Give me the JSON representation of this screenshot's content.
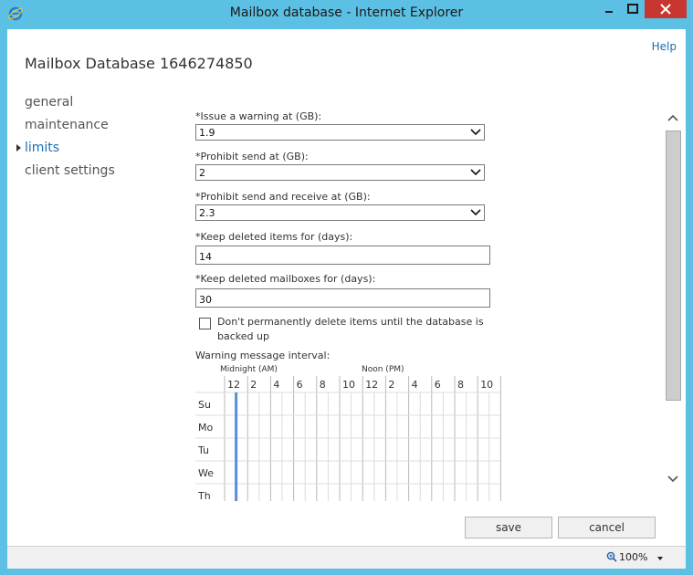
{
  "window": {
    "title": "Mailbox database - Internet Explorer",
    "controls": [
      "minimize",
      "maximize",
      "close"
    ]
  },
  "header": {
    "help_label": "Help",
    "page_title": "Mailbox Database 1646274850"
  },
  "sidebar": {
    "items": [
      {
        "label": "general",
        "active": false
      },
      {
        "label": "maintenance",
        "active": false
      },
      {
        "label": "limits",
        "active": true
      },
      {
        "label": "client settings",
        "active": false
      }
    ]
  },
  "form": {
    "issue_warning": {
      "label": "*Issue a warning at (GB):",
      "value": "1.9"
    },
    "prohibit_send": {
      "label": "*Prohibit send at (GB):",
      "value": "2"
    },
    "prohibit_send_receive": {
      "label": "*Prohibit send and receive at (GB):",
      "value": "2.3"
    },
    "keep_deleted_items": {
      "label": "*Keep deleted items for (days):",
      "value": "14"
    },
    "keep_deleted_mailboxes": {
      "label": "*Keep deleted mailboxes for (days):",
      "value": "30"
    },
    "dont_delete_until_backup": {
      "label": "Don't permanently delete items until the database is backed up",
      "checked": false
    }
  },
  "schedule": {
    "label": "Warning message interval:",
    "midnight_label": "Midnight (AM)",
    "noon_label": "Noon (PM)",
    "hour_labels": [
      "12",
      "2",
      "4",
      "6",
      "8",
      "10",
      "12",
      "2",
      "4",
      "6",
      "8",
      "10"
    ],
    "days": [
      "Su",
      "Mo",
      "Tu",
      "We",
      "Th"
    ],
    "selected_hour_index": 1
  },
  "actions": {
    "save_label": "save",
    "cancel_label": "cancel"
  },
  "statusbar": {
    "zoom": "100%"
  },
  "colors": {
    "titlebar": "#5bc0e3",
    "accent": "#1a6fb0",
    "schedule_selection": "#5b8dd9",
    "close_button": "#c7372f"
  }
}
